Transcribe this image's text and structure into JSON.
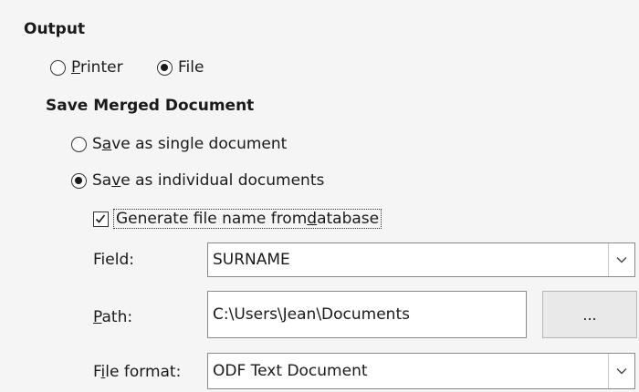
{
  "output": {
    "heading": "Output",
    "printer_radio": {
      "pre": "",
      "ul": "P",
      "post": "rinter",
      "selected": false
    },
    "file_radio": {
      "label": "File",
      "selected": true
    }
  },
  "save_merged": {
    "heading": "Save Merged Document",
    "single_radio": {
      "pre": "S",
      "ul": "a",
      "post": "ve as single document",
      "selected": false
    },
    "individual_radio": {
      "pre": "Sa",
      "ul": "v",
      "post": "e as individual documents",
      "selected": true
    },
    "generate_checkbox": {
      "pre": "Generate file name from ",
      "ul": "d",
      "post": "atabase",
      "checked": true
    }
  },
  "form": {
    "field_label": "Field:",
    "field_value": "SURNAME",
    "path_label": {
      "ul": "P",
      "post": "ath:"
    },
    "path_value": "C:\\Users\\Jean\\Documents",
    "browse_button": "...",
    "format_label": {
      "pre": "F",
      "ul": "i",
      "post": "le format:"
    },
    "format_value": "ODF Text Document"
  },
  "icons": {
    "dropdown": "chevron-down-icon",
    "check": "checkmark-icon"
  }
}
